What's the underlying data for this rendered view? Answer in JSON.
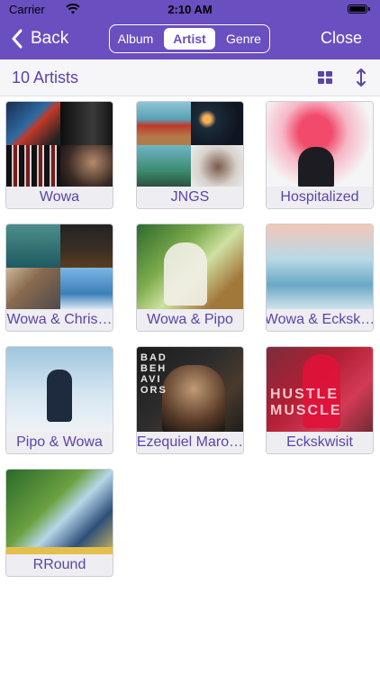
{
  "status_bar": {
    "carrier": "Carrier",
    "time": "2:10 AM",
    "battery_level": 1.0
  },
  "nav": {
    "back_label": "Back",
    "segments": [
      {
        "label": "Album",
        "active": false
      },
      {
        "label": "Artist",
        "active": true
      },
      {
        "label": "Genre",
        "active": false
      }
    ],
    "close_label": "Close",
    "accent_color": "#6a4fc0"
  },
  "toolbar": {
    "count_label": "10 Artists",
    "grid_icon": "grid-view-icon",
    "sort_icon": "sort-icon"
  },
  "artists": [
    {
      "name": "Wowa"
    },
    {
      "name": "JNGS"
    },
    {
      "name": "Hospitalized"
    },
    {
      "name": "Wowa & Chris…"
    },
    {
      "name": "Wowa & Pipo"
    },
    {
      "name": "Wowa & Ecksk…"
    },
    {
      "name": "Pipo & Wowa"
    },
    {
      "name": "Ezequiel Maro…"
    },
    {
      "name": "Eckskwisit"
    },
    {
      "name": "RRound"
    }
  ],
  "album_art_text": {
    "ezequiel": "BAD\nBEH\nAVI\nORS",
    "eckskwisit": "HUSTLE\nMUSCLE"
  }
}
